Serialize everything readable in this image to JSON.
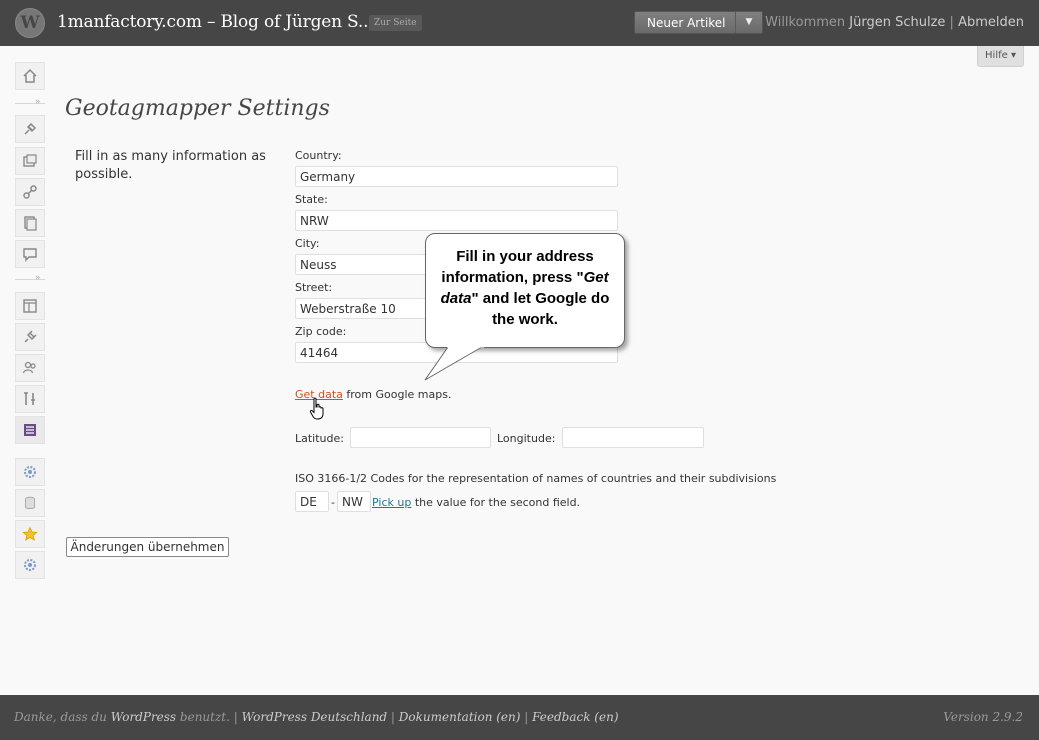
{
  "header": {
    "logo_glyph": "W",
    "site_title": "1manfactory.com – Blog of Jürgen S...",
    "visit_site": "Zur Seite",
    "new_post": "Neuer Artikel",
    "new_post_arrow": "▼",
    "welcome": "Willkommen",
    "user": "Jürgen Schulze",
    "separator": "|",
    "logout": "Abmelden"
  },
  "help": {
    "label": "Hilfe ▾"
  },
  "menu_icons": [
    "dashboard-icon",
    "posts-icon",
    "media-icon",
    "links-icon",
    "pages-icon",
    "comments-icon",
    "appearance-icon",
    "plugins-icon",
    "users-icon",
    "tools-icon",
    "settings-icon",
    "plugin-gear-icon",
    "database-icon",
    "star-icon",
    "plugin-gear-icon-2"
  ],
  "page": {
    "title": "Geotagmapper Settings",
    "intro": "Fill in as many information as possible."
  },
  "form": {
    "country_label": "Country:",
    "country": "Germany",
    "state_label": "State:",
    "state": "NRW",
    "city_label": "City:",
    "city": "Neuss",
    "street_label": "Street:",
    "street": "Weberstraße 10",
    "zip_label": "Zip code:",
    "zip": "41464",
    "get_data_link": "Get data",
    "get_data_suffix": " from Google maps.",
    "latitude_label": "Latitude:",
    "latitude": "",
    "longitude_label": "Longitude:",
    "longitude": "",
    "iso_description": "ISO 3166-1/2 Codes for the representation of names of countries and their subdivisions",
    "iso_country": "DE",
    "iso_dash": "-",
    "iso_subdivision": "NW",
    "pickup_link": "Pick up",
    "pickup_suffix": " the value for the second field.",
    "submit": "Änderungen übernehmen"
  },
  "callout": {
    "line1": "Fill in your address information, press \"",
    "emph": "Get data",
    "line2": "\" and let Google do the work."
  },
  "footer": {
    "thanks_prefix": "Danke, dass du ",
    "wordpress": "WordPress",
    "thanks_suffix": " benutzt.",
    "sep": " | ",
    "wp_de": "WordPress Deutschland",
    "docs": "Dokumentation (en)",
    "feedback": "Feedback (en)",
    "version": "Version 2.9.2"
  }
}
